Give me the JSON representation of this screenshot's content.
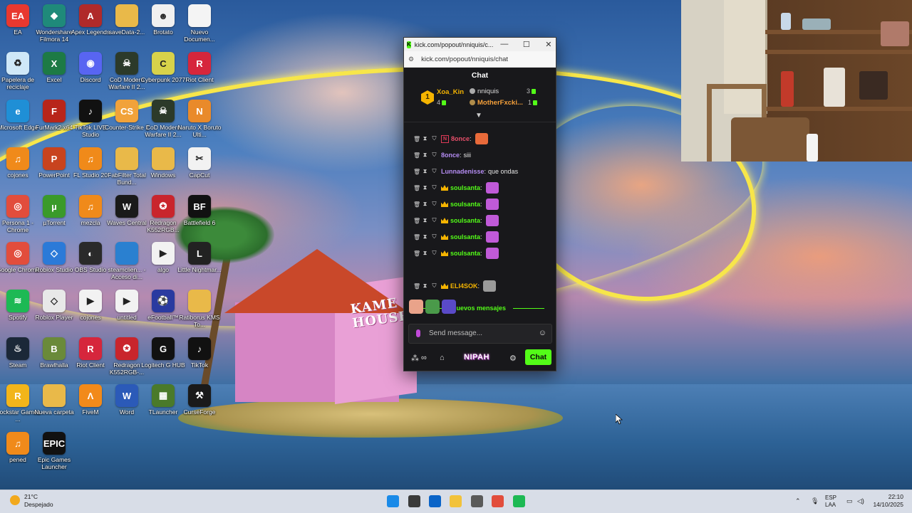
{
  "desktop": {
    "icons": [
      {
        "label": "EA",
        "color": "#e8382f",
        "glyph": "EA"
      },
      {
        "label": "Wondershare Filmora 14",
        "color": "#1f8a7a",
        "glyph": "◆"
      },
      {
        "label": "Apex Legends",
        "color": "#b02a2a",
        "glyph": "A"
      },
      {
        "label": "saveData-2...",
        "color": "#e9b949",
        "glyph": ""
      },
      {
        "label": "Brotato",
        "color": "#f0f0f0",
        "glyph": "☻"
      },
      {
        "label": "Nuevo Documen...",
        "color": "#f4f4f4",
        "glyph": ""
      },
      {
        "label": "Papelera de reciclaje",
        "color": "#cfe8f8",
        "glyph": "♻"
      },
      {
        "label": "Excel",
        "color": "#1d7a45",
        "glyph": "X"
      },
      {
        "label": "Discord",
        "color": "#5865f2",
        "glyph": "◉"
      },
      {
        "label": "CoD Modern Warfare II 2...",
        "color": "#2c3a2a",
        "glyph": "☠"
      },
      {
        "label": "Cyberpunk 2077",
        "color": "#d8d24a",
        "glyph": "C"
      },
      {
        "label": "Riot Client",
        "color": "#d6263c",
        "glyph": "R"
      },
      {
        "label": "Microsoft Edge",
        "color": "#1f8fd6",
        "glyph": "e"
      },
      {
        "label": "FurMark2 x64",
        "color": "#b8251a",
        "glyph": "F"
      },
      {
        "label": "TikTok LIVE Studio",
        "color": "#111111",
        "glyph": "♪"
      },
      {
        "label": "Counter-Strike 2",
        "color": "#f1a23a",
        "glyph": "CS"
      },
      {
        "label": "CoD Modern Warfare II 2...",
        "color": "#2c3a2a",
        "glyph": "☠"
      },
      {
        "label": "Naruto X Boruto Ulti...",
        "color": "#e98a2a",
        "glyph": "N"
      },
      {
        "label": "cojones",
        "color": "#f08a1a",
        "glyph": "♫"
      },
      {
        "label": "PowerPoint",
        "color": "#c8431e",
        "glyph": "P"
      },
      {
        "label": "FL Studio 20",
        "color": "#f08a1a",
        "glyph": "♫"
      },
      {
        "label": "FabFilter Total Bund...",
        "color": "#e9b949",
        "glyph": ""
      },
      {
        "label": "Windows",
        "color": "#e9b949",
        "glyph": ""
      },
      {
        "label": "CapCut",
        "color": "#f2f2f2",
        "glyph": "✂"
      },
      {
        "label": "Persona 1 - Chrome",
        "color": "#e24d3c",
        "glyph": "◎"
      },
      {
        "label": "µTorrent",
        "color": "#3a9a2a",
        "glyph": "µ"
      },
      {
        "label": "mezcla",
        "color": "#f08a1a",
        "glyph": "♫"
      },
      {
        "label": "Waves Central",
        "color": "#1a1a1a",
        "glyph": "W"
      },
      {
        "label": "Redragon K552RGB...",
        "color": "#c9252c",
        "glyph": "✪"
      },
      {
        "label": "Battlefield 6",
        "color": "#111111",
        "glyph": "BF"
      },
      {
        "label": "Google Chrome",
        "color": "#e24d3c",
        "glyph": "◎"
      },
      {
        "label": "Roblox Studio",
        "color": "#2b7ad8",
        "glyph": "◇"
      },
      {
        "label": "OBS Studio",
        "color": "#2a2a2a",
        "glyph": "◐"
      },
      {
        "label": "steamclien... - Acceso di...",
        "color": "#2a80d0",
        "glyph": ""
      },
      {
        "label": "algo",
        "color": "#f2f2f2",
        "glyph": "▶"
      },
      {
        "label": "Little Nightmar...",
        "color": "#222222",
        "glyph": "L"
      },
      {
        "label": "Spotify",
        "color": "#1db954",
        "glyph": "≋"
      },
      {
        "label": "Roblox Player",
        "color": "#e8e8e8",
        "glyph": "◇"
      },
      {
        "label": "cojones",
        "color": "#f2f2f2",
        "glyph": "▶"
      },
      {
        "label": "untitled",
        "color": "#f2f2f2",
        "glyph": "▶"
      },
      {
        "label": "eFootball™",
        "color": "#2a3aa0",
        "glyph": "⚽"
      },
      {
        "label": "Ratiborus KMS To...",
        "color": "#e9b949",
        "glyph": ""
      },
      {
        "label": "Steam",
        "color": "#1b2838",
        "glyph": "♨"
      },
      {
        "label": "Brawlhalla",
        "color": "#6a8a3a",
        "glyph": "B"
      },
      {
        "label": "Riot Client",
        "color": "#d6263c",
        "glyph": "R"
      },
      {
        "label": "Redragon K552RGB-...",
        "color": "#c9252c",
        "glyph": "✪"
      },
      {
        "label": "Logitech G HUB",
        "color": "#111111",
        "glyph": "G"
      },
      {
        "label": "TikTok",
        "color": "#111111",
        "glyph": "♪"
      },
      {
        "label": "Rockstar Games ...",
        "color": "#f2b51a",
        "glyph": "R"
      },
      {
        "label": "Nueva carpeta",
        "color": "#e9b949",
        "glyph": ""
      },
      {
        "label": "FiveM",
        "color": "#f28a1a",
        "glyph": "Λ"
      },
      {
        "label": "Word",
        "color": "#2b5ab8",
        "glyph": "W"
      },
      {
        "label": "TLauncher",
        "color": "#4a7a2a",
        "glyph": "▦"
      },
      {
        "label": "CurseForge",
        "color": "#1a1a1a",
        "glyph": "⚒"
      },
      {
        "label": "pened",
        "color": "#f08a1a",
        "glyph": "♫"
      },
      {
        "label": "Epic Games Launcher",
        "color": "#111111",
        "glyph": "EPIC"
      }
    ],
    "house_sign": "KAME\nHOUSE"
  },
  "window": {
    "title": "kick.com/popout/nniquis/c...",
    "favicon": "K",
    "controls": [
      "—",
      "☐",
      "✕"
    ],
    "address": "kick.com/popout/nniquis/chat",
    "tune_icon": "⚙"
  },
  "chat": {
    "header": "Chat",
    "leaderboard": {
      "top_rank": "1",
      "top_user": "Xoa_Kin",
      "top_count": "4",
      "second_user": "nniquis",
      "second_count": "3",
      "third_user": "MotherFxcki...",
      "third_count": "1"
    },
    "messages": [
      {
        "user": "8once",
        "color": "#e64f6a",
        "text": "",
        "emote": "#e86a3a",
        "badges": [
          "del",
          "timeout",
          "mod",
          "kick"
        ]
      },
      {
        "user": "8once",
        "color": "#b48cf2",
        "text": "siii",
        "emote": "",
        "badges": [
          "del",
          "timeout",
          "mod"
        ]
      },
      {
        "user": "Lunnadenisse",
        "color": "#b48cf2",
        "text": "que ondas",
        "emote": "",
        "badges": [
          "del",
          "timeout",
          "mod"
        ]
      },
      {
        "user": "soulsanta",
        "color": "#53fc18",
        "text": "",
        "emote": "#c05ad8",
        "badges": [
          "del",
          "timeout",
          "mod",
          "crown"
        ]
      },
      {
        "user": "soulsanta",
        "color": "#53fc18",
        "text": "",
        "emote": "#c05ad8",
        "badges": [
          "del",
          "timeout",
          "mod",
          "crown"
        ]
      },
      {
        "user": "soulsanta",
        "color": "#53fc18",
        "text": "",
        "emote": "#c05ad8",
        "badges": [
          "del",
          "timeout",
          "mod",
          "crown"
        ]
      },
      {
        "user": "soulsanta",
        "color": "#53fc18",
        "text": "",
        "emote": "#c05ad8",
        "badges": [
          "del",
          "timeout",
          "mod",
          "crown"
        ]
      },
      {
        "user": "soulsanta",
        "color": "#53fc18",
        "text": "",
        "emote": "#c05ad8",
        "badges": [
          "del",
          "timeout",
          "mod",
          "crown"
        ]
      },
      {
        "user": "ELI4SOK",
        "color": "#f5b400",
        "text": "",
        "emote": "#9a9a9a",
        "badges": [
          "del",
          "timeout",
          "mod",
          "crown"
        ]
      }
    ],
    "new_messages_label": "Nuevos mensajes",
    "input_placeholder": "Send message...",
    "emote_button": "☺",
    "send_label": "Chat",
    "nipah_label": "NIPAH"
  },
  "taskbar": {
    "temperature": "21°C",
    "weather_text": "Despejado",
    "apps": [
      "windows-start",
      "task-view",
      "outlook",
      "file-explorer",
      "github-copilot",
      "chrome",
      "spotify"
    ],
    "language": "ESP",
    "layout": "LAA",
    "time": "22:10",
    "date": "14/10/2025",
    "colors": {
      "windows-start": "#1a8ae8",
      "task-view": "#3a3a3a",
      "outlook": "#0a64c8",
      "file-explorer": "#f2c23a",
      "github-copilot": "#5a5a5a",
      "chrome": "#e24d3c",
      "spotify": "#1db954"
    }
  },
  "accent": "#53fc18"
}
